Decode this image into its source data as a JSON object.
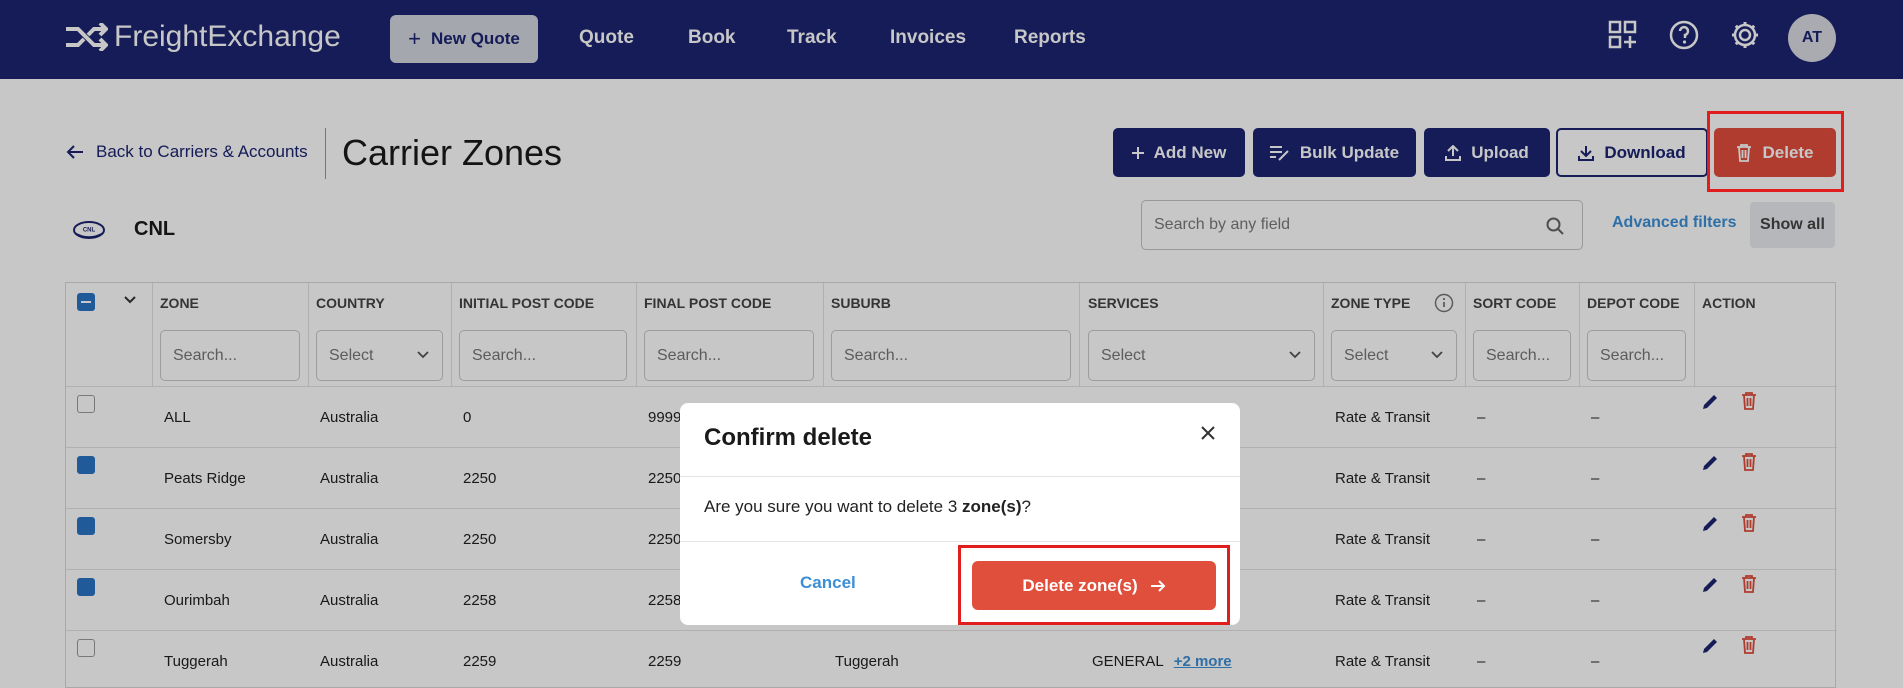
{
  "app": {
    "brand": "FreightExchange"
  },
  "nav": {
    "new_quote": "New Quote",
    "links": [
      "Quote",
      "Book",
      "Track",
      "Invoices",
      "Reports"
    ],
    "avatar": "AT"
  },
  "header": {
    "back": "Back to Carriers & Accounts",
    "title": "Carrier Zones",
    "buttons": {
      "add_new": "Add New",
      "bulk_update": "Bulk Update",
      "upload": "Upload",
      "download": "Download",
      "delete": "Delete"
    }
  },
  "carrier": {
    "name": "CNL",
    "logo_text": "CNL"
  },
  "search": {
    "placeholder": "Search by any field",
    "advanced": "Advanced filters",
    "show_all": "Show all"
  },
  "table": {
    "columns": [
      "ZONE",
      "COUNTRY",
      "INITIAL POST CODE",
      "FINAL POST CODE",
      "SUBURB",
      "SERVICES",
      "ZONE TYPE",
      "SORT CODE",
      "DEPOT CODE",
      "ACTION"
    ],
    "filters": {
      "zone": "Search...",
      "country": "Select",
      "initial": "Search...",
      "final": "Search...",
      "suburb": "Search...",
      "services": "Select",
      "zone_type": "Select",
      "sort": "Search...",
      "depot": "Search..."
    },
    "rows": [
      {
        "checked": false,
        "zone": "ALL",
        "country": "Australia",
        "initial": "0",
        "final": "9999",
        "suburb": "",
        "services": "",
        "more": "",
        "zone_type": "Rate & Transit",
        "sort": "–",
        "depot": "–"
      },
      {
        "checked": true,
        "zone": "Peats Ridge",
        "country": "Australia",
        "initial": "2250",
        "final": "2250",
        "suburb": "",
        "services": "",
        "more": "",
        "zone_type": "Rate & Transit",
        "sort": "–",
        "depot": "–"
      },
      {
        "checked": true,
        "zone": "Somersby",
        "country": "Australia",
        "initial": "2250",
        "final": "2250",
        "suburb": "",
        "services": "",
        "more": "",
        "zone_type": "Rate & Transit",
        "sort": "–",
        "depot": "–"
      },
      {
        "checked": true,
        "zone": "Ourimbah",
        "country": "Australia",
        "initial": "2258",
        "final": "2258",
        "suburb": "",
        "services": "",
        "more": "",
        "zone_type": "Rate & Transit",
        "sort": "–",
        "depot": "–"
      },
      {
        "checked": false,
        "zone": "Tuggerah",
        "country": "Australia",
        "initial": "2259",
        "final": "2259",
        "suburb": "Tuggerah",
        "services": "GENERAL",
        "more": "+2 more",
        "zone_type": "Rate & Transit",
        "sort": "–",
        "depot": "–"
      }
    ]
  },
  "modal": {
    "title": "Confirm delete",
    "msg_prefix": "Are you sure you want to delete ",
    "count": "3",
    "unit": "zone(s)",
    "msg_suffix": "?",
    "cancel": "Cancel",
    "confirm": "Delete zone(s)"
  },
  "colors": {
    "navy": "#1b2470",
    "danger": "#e04e3c",
    "link": "#3c8fd6",
    "checkbox": "#2a74c4",
    "highlight": "#e11d1d"
  }
}
